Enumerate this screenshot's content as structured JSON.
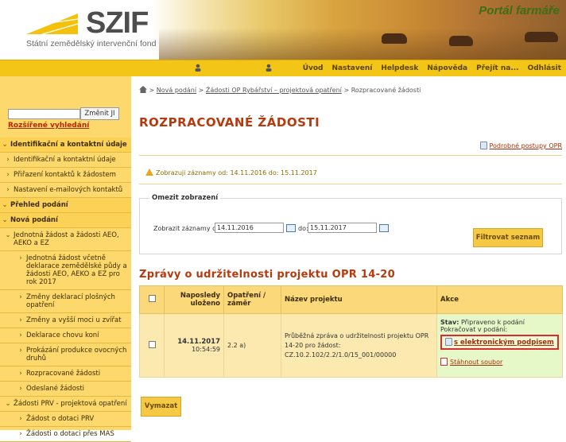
{
  "header": {
    "logo_text": "SZIF",
    "logo_subtitle": "Státní zemědělský intervenční fond",
    "portal_title": "Portál farmáře"
  },
  "topbar": {
    "nav": [
      "Úvod",
      "Nastavení",
      "Helpdesk",
      "Nápověda",
      "Přejít na...",
      "Odhlásit"
    ]
  },
  "sidebar": {
    "search_placeholder": "",
    "search_button": "Změnit JI",
    "advanced_search": "Rozšířené vyhledání",
    "menu": [
      {
        "label": "Identifikační a kontaktní údaje",
        "arrow": "⌄",
        "level": 0
      },
      {
        "label": "Identifikační a kontaktní údaje",
        "arrow": "›",
        "level": 1
      },
      {
        "label": "Přiřazení kontaktů k žádostem",
        "arrow": "›",
        "level": 1
      },
      {
        "label": "Nastavení e-mailových kontaktů",
        "arrow": "›",
        "level": 1
      },
      {
        "label": "Přehled podání",
        "arrow": "⌄",
        "level": 0
      },
      {
        "label": "Nová podání",
        "arrow": "⌄",
        "level": 0
      },
      {
        "label": "Jednotná žádost a žádosti AEO, AEKO a EZ",
        "arrow": "⌄",
        "level": 2
      },
      {
        "label": "Jednotná žádost včetně deklarace zemědělské půdy a žádosti AEO, AEKO a EZ pro rok 2017",
        "arrow": "›",
        "level": 3
      },
      {
        "label": "Změny deklarací plošných opatření",
        "arrow": "›",
        "level": 3
      },
      {
        "label": "Změny a vyšší moci u zvířat",
        "arrow": "›",
        "level": 3
      },
      {
        "label": "Deklarace chovu koní",
        "arrow": "›",
        "level": 3
      },
      {
        "label": "Prokázání produkce ovocných druhů",
        "arrow": "›",
        "level": 3
      },
      {
        "label": "Rozpracované žádosti",
        "arrow": "›",
        "level": 3
      },
      {
        "label": "Odeslané žádosti",
        "arrow": "›",
        "level": 3
      },
      {
        "label": "Žádosti PRV - projektová opatření",
        "arrow": "⌄",
        "level": 2
      },
      {
        "label": "Žádost o dotaci PRV",
        "arrow": "›",
        "level": 3
      },
      {
        "label": "Žádosti o dotaci přes MAS",
        "arrow": "›",
        "level": 3
      }
    ]
  },
  "breadcrumb": {
    "sep": ">",
    "items": [
      "Nová podání",
      "Žádosti OP Rybářství – projektová opatření",
      "Rozpracované žádosti"
    ]
  },
  "main": {
    "title": "ROZPRACOVANÉ ŽÁDOSTI",
    "procedures_link": "Podrobné postupy OPR",
    "warning": "Zobrazuji záznamy od: 14.11.2016 do: 15.11.2017",
    "filter": {
      "legend": "Omezit zobrazení",
      "from_label": "Zobrazit záznamy od:",
      "from_value": "14.11.2016",
      "to_label": "do:",
      "to_value": "15.11.2017",
      "button": "Filtrovat seznam"
    },
    "section_title": "Zprávy o udržitelnosti projektu OPR 14-20",
    "table": {
      "headers": [
        "Naposledy uloženo",
        "Opatření / záměr",
        "Název projektu",
        "Akce"
      ],
      "row": {
        "date": "14.11.2017",
        "time": "10:54:59",
        "measure": "2.2 a)",
        "project": "Průběžná zpráva o udržitelnosti projektu OPR 14-20 pro žádost: CZ.10.2.102/2.2/1.0/15_001/00000",
        "status_label": "Stav:",
        "status_value": "Připraveno k podání",
        "continue": "Pokračovat v podání:",
        "sign_link": "s elektronickým podpisem",
        "download": "Stáhnout soubor"
      }
    },
    "delete_button": "Vymazat"
  },
  "colors": {
    "accent": "#b73a0f",
    "yellow": "#f3c517",
    "sidebar": "#fcd86d",
    "highlight": "#d62e2e"
  }
}
